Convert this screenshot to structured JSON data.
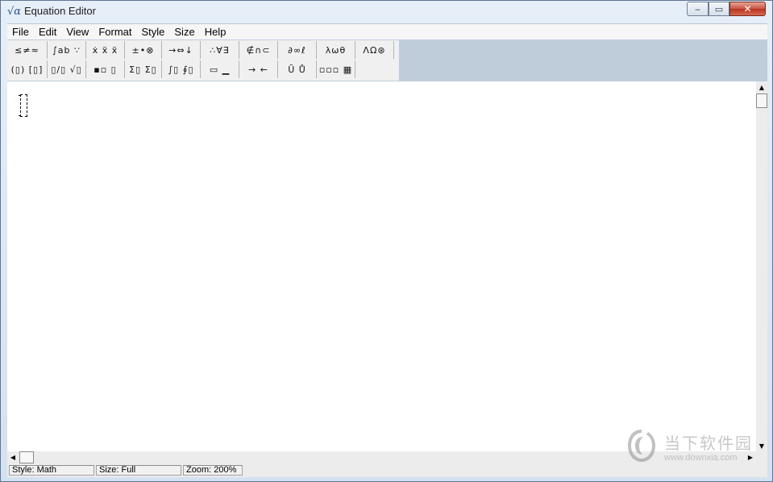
{
  "window": {
    "title": "Equation Editor",
    "icon": "sqrt-alpha-icon",
    "controls": {
      "minimize": "‒",
      "maximize": "▭",
      "close": "✕"
    }
  },
  "menu": [
    "File",
    "Edit",
    "View",
    "Format",
    "Style",
    "Size",
    "Help"
  ],
  "toolbar": {
    "row1": [
      {
        "name": "relational-symbols",
        "glyphs": "≤≠≈"
      },
      {
        "name": "spaces-ellipses",
        "glyphs": "∫ab ∵"
      },
      {
        "name": "embellishments",
        "glyphs": "ẋ ẍ ẍ"
      },
      {
        "name": "operator-symbols",
        "glyphs": "±•⊗"
      },
      {
        "name": "arrow-symbols",
        "glyphs": "→⇔↓"
      },
      {
        "name": "logical-symbols",
        "glyphs": "∴∀∃"
      },
      {
        "name": "set-theory-symbols",
        "glyphs": "∉∩⊂"
      },
      {
        "name": "miscellaneous-symbols",
        "glyphs": "∂∞ℓ"
      },
      {
        "name": "greek-lowercase",
        "glyphs": "λωθ"
      },
      {
        "name": "greek-uppercase",
        "glyphs": "ΛΩ⊛"
      }
    ],
    "row2": [
      {
        "name": "fence-templates",
        "glyphs": "(▯) [▯]"
      },
      {
        "name": "fraction-radical-templates",
        "glyphs": "▯/▯ √▯"
      },
      {
        "name": "subscript-superscript-templates",
        "glyphs": "▪▫ ▯"
      },
      {
        "name": "summation-templates",
        "glyphs": "Σ▯ Σ▯"
      },
      {
        "name": "integral-templates",
        "glyphs": "∫▯ ∮▯"
      },
      {
        "name": "underbar-overbar-templates",
        "glyphs": "▭ ▁"
      },
      {
        "name": "labeled-arrow-templates",
        "glyphs": "→ ←"
      },
      {
        "name": "products-set-theory-templates",
        "glyphs": "Ū Ů"
      },
      {
        "name": "matrix-templates",
        "glyphs": "▫▫▫ ▦"
      }
    ]
  },
  "editor": {
    "content": ""
  },
  "status": {
    "style": "Style: Math",
    "size": "Size: Full",
    "zoom": "Zoom: 200%"
  },
  "watermark": {
    "brand": "当下软件园",
    "url": "www.downxia.com"
  }
}
